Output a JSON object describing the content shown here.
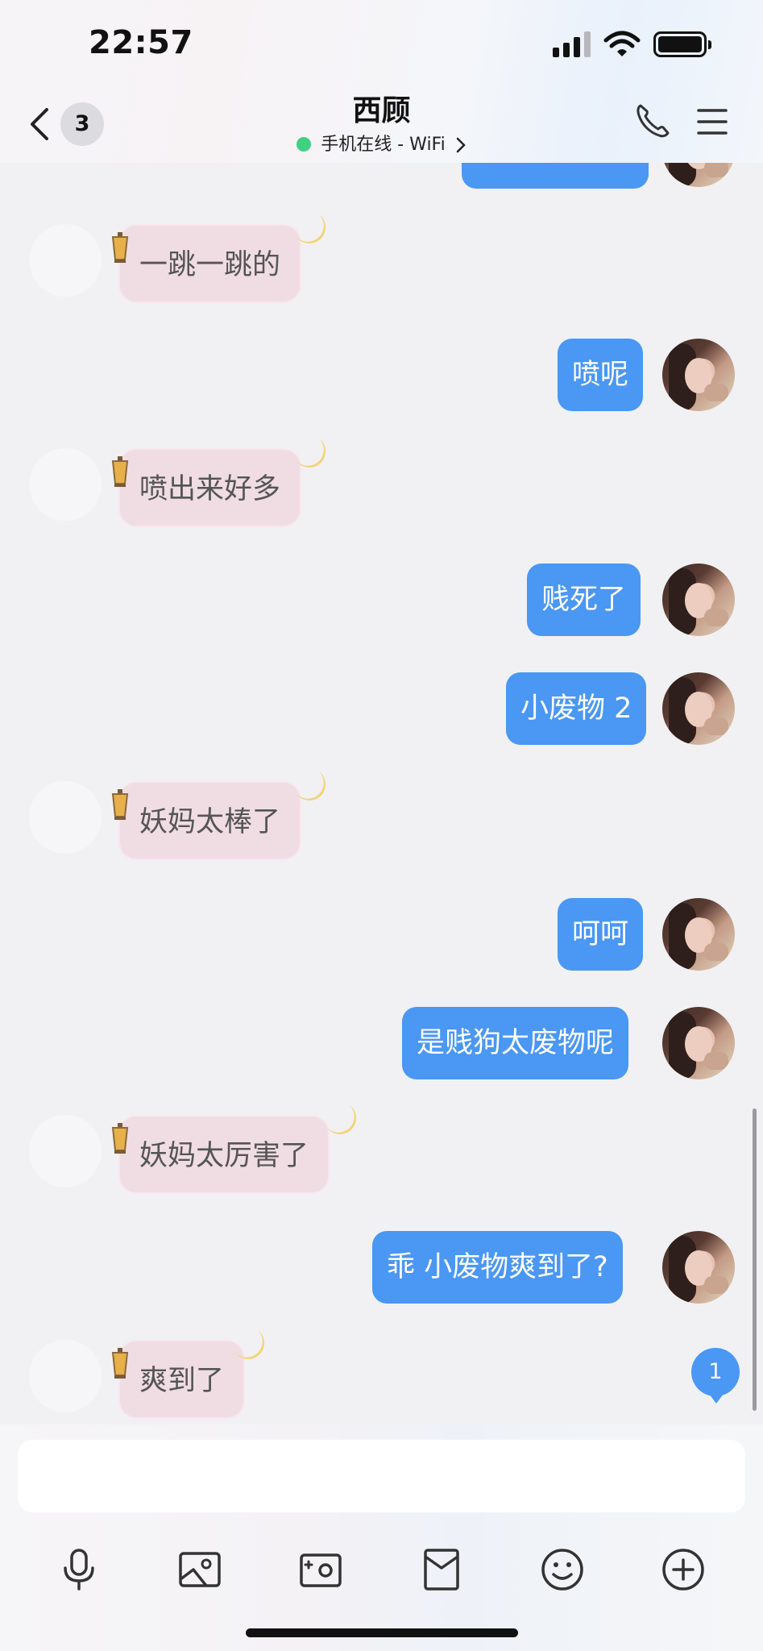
{
  "status_bar": {
    "time": "22:57"
  },
  "header": {
    "unread_count": "3",
    "title": "西顾",
    "subtitle": "手机在线 - WiFi"
  },
  "messages": [
    {
      "side": "out",
      "text": ""
    },
    {
      "side": "in",
      "text": "一跳一跳的"
    },
    {
      "side": "out",
      "text": "喷呢"
    },
    {
      "side": "in",
      "text": "喷出来好多"
    },
    {
      "side": "out",
      "text": "贱死了"
    },
    {
      "side": "out",
      "text": "小废物 2"
    },
    {
      "side": "in",
      "text": "妖妈太棒了"
    },
    {
      "side": "out",
      "text": "呵呵"
    },
    {
      "side": "out",
      "text": "是贱狗太废物呢"
    },
    {
      "side": "in",
      "text": "妖妈太厉害了"
    },
    {
      "side": "out",
      "text": "乖 小废物爽到了?"
    },
    {
      "side": "in",
      "text": "爽到了"
    }
  ],
  "new_message_badge": "1",
  "input": {
    "placeholder": ""
  },
  "toolbar": [
    "microphone-icon",
    "image-icon",
    "camera-icon",
    "red-envelope-icon",
    "emoji-icon",
    "plus-icon"
  ],
  "colors": {
    "outgoing_bubble": "#4a97f4",
    "incoming_bubble": "#f0dde3",
    "online_dot": "#3fd17f"
  }
}
